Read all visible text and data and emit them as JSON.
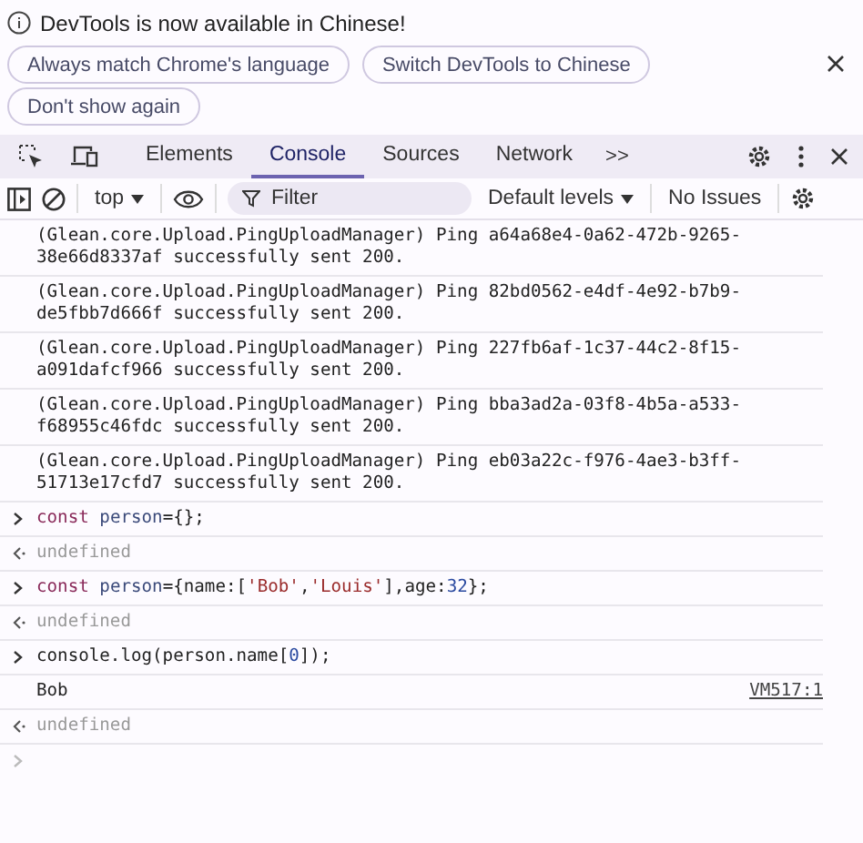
{
  "infobar": {
    "message": "DevTools is now available in Chinese!",
    "buttons": [
      "Always match Chrome's language",
      "Switch DevTools to Chinese",
      "Don't show again"
    ]
  },
  "tabs": [
    {
      "label": "Elements",
      "selected": false
    },
    {
      "label": "Console",
      "selected": true
    },
    {
      "label": "Sources",
      "selected": false
    },
    {
      "label": "Network",
      "selected": false
    }
  ],
  "more_tabs": ">>",
  "toolbar": {
    "context": "top",
    "filter": {
      "placeholder": "Filter"
    },
    "levels": "Default levels",
    "issues": "No Issues"
  },
  "console": [
    {
      "kind": "log",
      "text": "(Glean.core.Upload.PingUploadManager) Ping a64a68e4-0a62-472b-9265-38e66d8337af successfully sent 200."
    },
    {
      "kind": "log",
      "text": "(Glean.core.Upload.PingUploadManager) Ping 82bd0562-e4df-4e92-b7b9-de5fbb7d666f successfully sent 200."
    },
    {
      "kind": "log",
      "text": "(Glean.core.Upload.PingUploadManager) Ping 227fb6af-1c37-44c2-8f15-a091dafcf966 successfully sent 200."
    },
    {
      "kind": "log",
      "text": "(Glean.core.Upload.PingUploadManager) Ping bba3ad2a-03f8-4b5a-a533-f68955c46fdc successfully sent 200."
    },
    {
      "kind": "log",
      "text": "(Glean.core.Upload.PingUploadManager) Ping eb03a22c-f976-4ae3-b3ff-51713e17cfd7 successfully sent 200."
    },
    {
      "kind": "input",
      "tokens": [
        {
          "kind": "keyword",
          "text": "const"
        },
        {
          "kind": "variable",
          "text": " person"
        },
        {
          "kind": "plain",
          "text": "={};"
        }
      ]
    },
    {
      "kind": "result",
      "text": "undefined"
    },
    {
      "kind": "input",
      "tokens": [
        {
          "kind": "keyword",
          "text": "const"
        },
        {
          "kind": "variable",
          "text": " person"
        },
        {
          "kind": "plain",
          "text": "={name:["
        },
        {
          "kind": "string",
          "text": "'Bob'"
        },
        {
          "kind": "plain",
          "text": ","
        },
        {
          "kind": "string",
          "text": "'Louis'"
        },
        {
          "kind": "plain",
          "text": "],age:"
        },
        {
          "kind": "number",
          "text": "32"
        },
        {
          "kind": "plain",
          "text": "};"
        }
      ]
    },
    {
      "kind": "result",
      "text": "undefined"
    },
    {
      "kind": "input",
      "tokens": [
        {
          "kind": "plain",
          "text": "console.log(person.name["
        },
        {
          "kind": "number",
          "text": "0"
        },
        {
          "kind": "plain",
          "text": "]);"
        }
      ]
    },
    {
      "kind": "output",
      "text": "Bob",
      "source": "VM517:1"
    },
    {
      "kind": "result",
      "text": "undefined"
    },
    {
      "kind": "prompt"
    }
  ]
}
